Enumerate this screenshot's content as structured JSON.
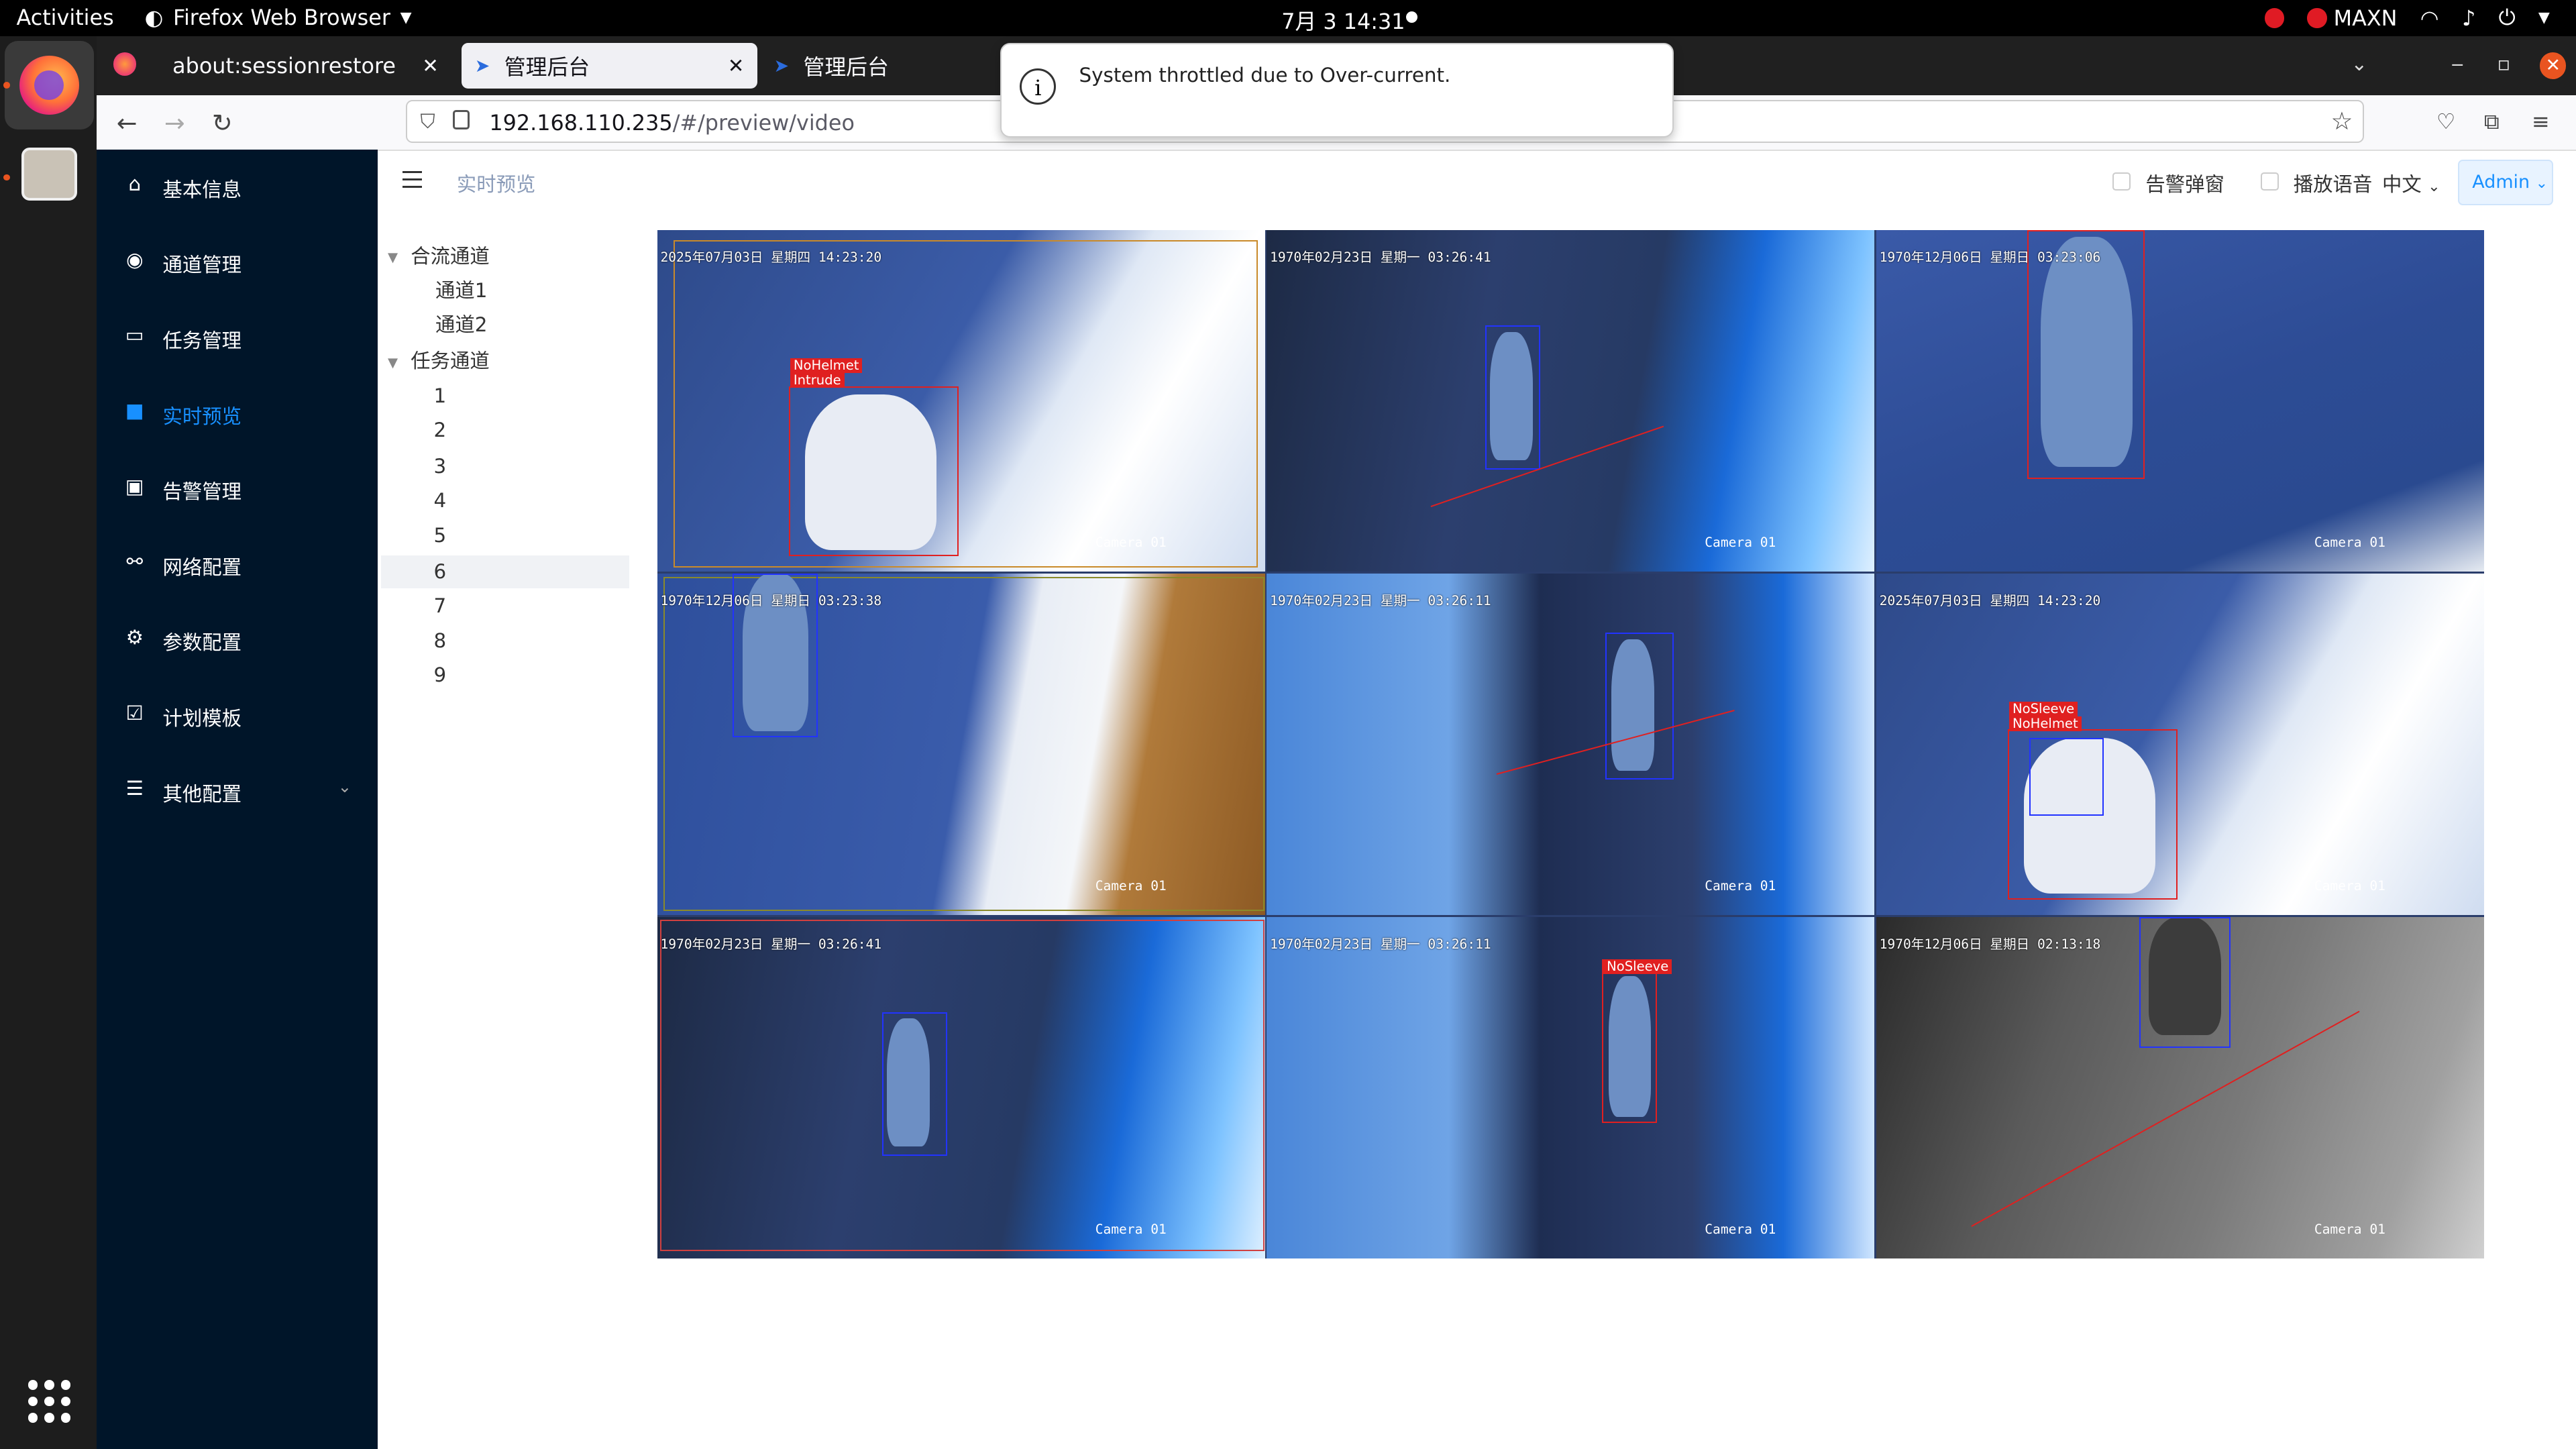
{
  "system": {
    "activities": "Activities",
    "app_name": "Firefox Web Browser",
    "clock": "7月 3  14:31",
    "power_mode": "MAXN"
  },
  "browser": {
    "tabs": [
      {
        "label": "about:sessionrestore",
        "selected": false
      },
      {
        "label": "管理后台",
        "selected": true
      },
      {
        "label": "管理后台",
        "selected": false
      }
    ],
    "url_host": "192.168.110.235",
    "url_path": "/#/preview/video"
  },
  "notification": {
    "message": "System throttled due to Over-current."
  },
  "sidebar": {
    "items": [
      {
        "label": "基本信息",
        "icon": "home-icon"
      },
      {
        "label": "通道管理",
        "icon": "camera-icon"
      },
      {
        "label": "任务管理",
        "icon": "task-icon"
      },
      {
        "label": "实时预览",
        "icon": "preview-icon",
        "active": true
      },
      {
        "label": "告警管理",
        "icon": "alarm-icon"
      },
      {
        "label": "网络配置",
        "icon": "network-icon"
      },
      {
        "label": "参数配置",
        "icon": "gear-icon"
      },
      {
        "label": "计划模板",
        "icon": "calendar-check-icon"
      },
      {
        "label": "其他配置",
        "icon": "sliders-icon"
      }
    ]
  },
  "header": {
    "breadcrumb": "实时预览",
    "alarm_popup_label": "告警弹窗",
    "play_voice_label": "播放语音",
    "language": "中文",
    "user": "Admin"
  },
  "tree": {
    "group1": {
      "label": "合流通道",
      "children": [
        "通道1",
        "通道2"
      ]
    },
    "group2": {
      "label": "任务通道",
      "children": [
        "1",
        "2",
        "3",
        "4",
        "5",
        "6",
        "7",
        "8",
        "9"
      ]
    },
    "selected": "6"
  },
  "videos": [
    {
      "timestamp": "2025年07月03日 星期四 14:23:20",
      "camera": "Camera 01",
      "tags": [
        "NoHelmet",
        "Intrude"
      ]
    },
    {
      "timestamp": "1970年02月23日 星期一 03:26:41",
      "camera": "Camera 01",
      "tags": []
    },
    {
      "timestamp": "1970年12月06日 星期日 03:23:06",
      "camera": "Camera 01",
      "tags": []
    },
    {
      "timestamp": "1970年12月06日 星期日 03:23:38",
      "camera": "Camera 01",
      "tags": []
    },
    {
      "timestamp": "1970年02月23日 星期一 03:26:11",
      "camera": "Camera 01",
      "tags": []
    },
    {
      "timestamp": "2025年07月03日 星期四 14:23:20",
      "camera": "Camera 01",
      "tags": [
        "NoSleeve",
        "NoHelmet"
      ]
    },
    {
      "timestamp": "1970年02月23日 星期一 03:26:41",
      "camera": "Camera 01",
      "tags": []
    },
    {
      "timestamp": "1970年02月23日 星期一 03:26:11",
      "camera": "Camera 01",
      "tags": [
        "NoSleeve"
      ]
    },
    {
      "timestamp": "1970年12月06日 星期日 02:13:18",
      "camera": "Camera 01",
      "tags": []
    }
  ],
  "colors": {
    "sidebar_bg": "#001529",
    "accent": "#1890ff",
    "alert_red": "#e02020"
  }
}
